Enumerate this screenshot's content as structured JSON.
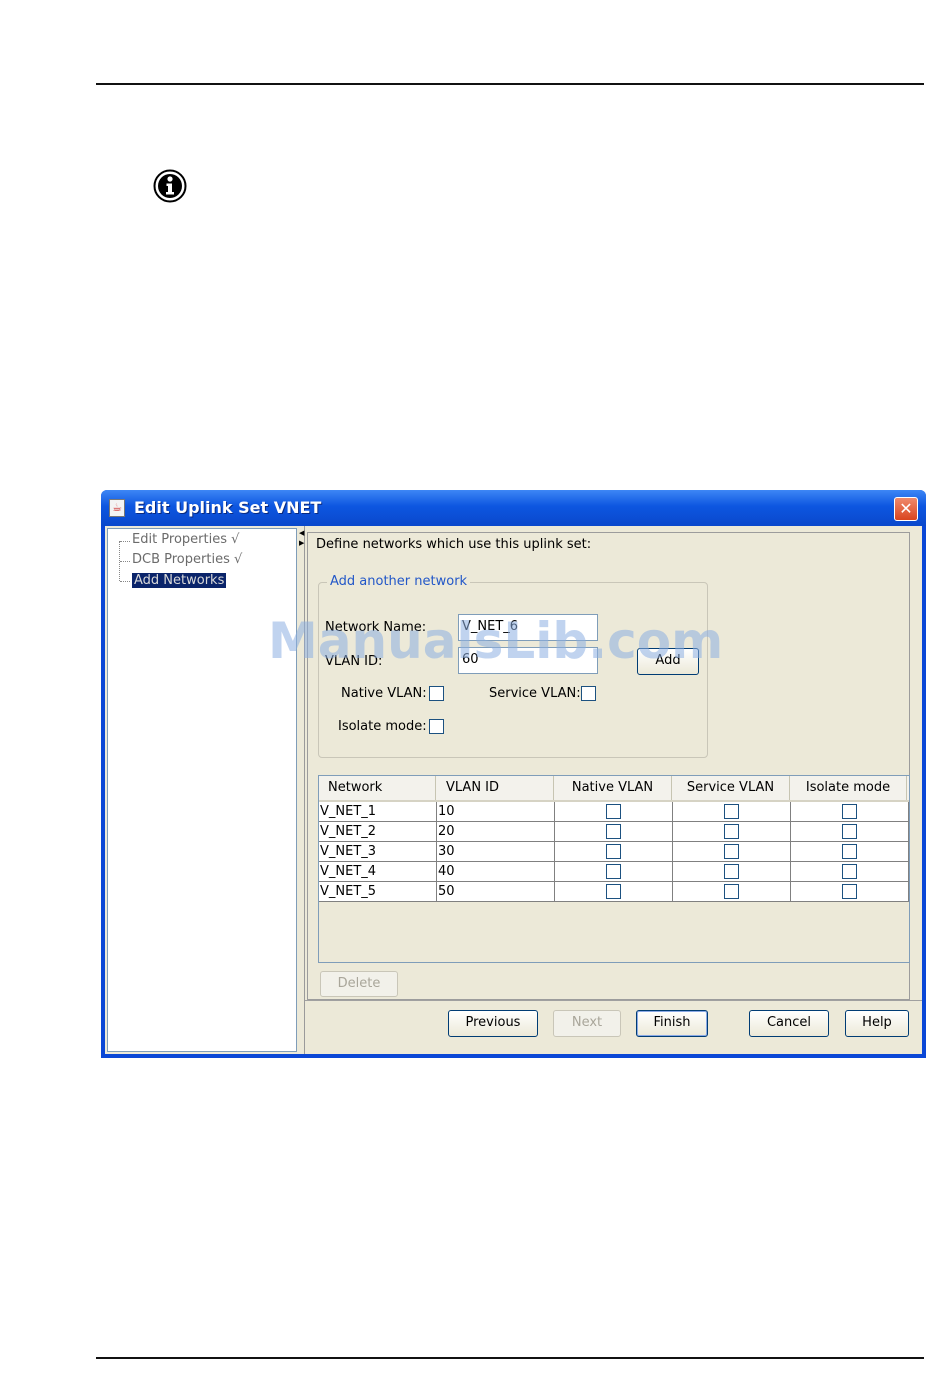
{
  "window": {
    "title": "Edit Uplink Set VNET",
    "close_glyph": "✕",
    "app_glyph": "☕"
  },
  "tree": {
    "items": [
      {
        "label": "Edit Properties √"
      },
      {
        "label": "DCB Properties √"
      },
      {
        "label": "Add Networks"
      }
    ]
  },
  "main": {
    "instruction": "Define networks which use this uplink set:",
    "group": {
      "legend": "Add another network",
      "network_name_label": "Network Name:",
      "network_name_value": "V_NET_6",
      "vlan_id_label": "VLAN ID:",
      "vlan_id_value": "60",
      "add_label": "Add",
      "native_vlan_label": "Native VLAN:",
      "service_vlan_label": "Service VLAN:",
      "isolate_mode_label": "Isolate mode:"
    },
    "table": {
      "columns": [
        "Network",
        "VLAN ID",
        "Native VLAN",
        "Service VLAN",
        "Isolate mode"
      ],
      "rows": [
        {
          "network": "V_NET_1",
          "vlan": "10"
        },
        {
          "network": "V_NET_2",
          "vlan": "20"
        },
        {
          "network": "V_NET_3",
          "vlan": "30"
        },
        {
          "network": "V_NET_4",
          "vlan": "40"
        },
        {
          "network": "V_NET_5",
          "vlan": "50"
        }
      ]
    },
    "delete_label": "Delete"
  },
  "footer": {
    "previous_label": "Previous",
    "next_label": "Next",
    "finish_label": "Finish",
    "cancel_label": "Cancel",
    "help_label": "Help"
  },
  "watermark": "ManualsLib.com",
  "colors": {
    "title_bar": "#0d56e0",
    "selection": "#0a246a",
    "legend_text": "#2257c8"
  }
}
